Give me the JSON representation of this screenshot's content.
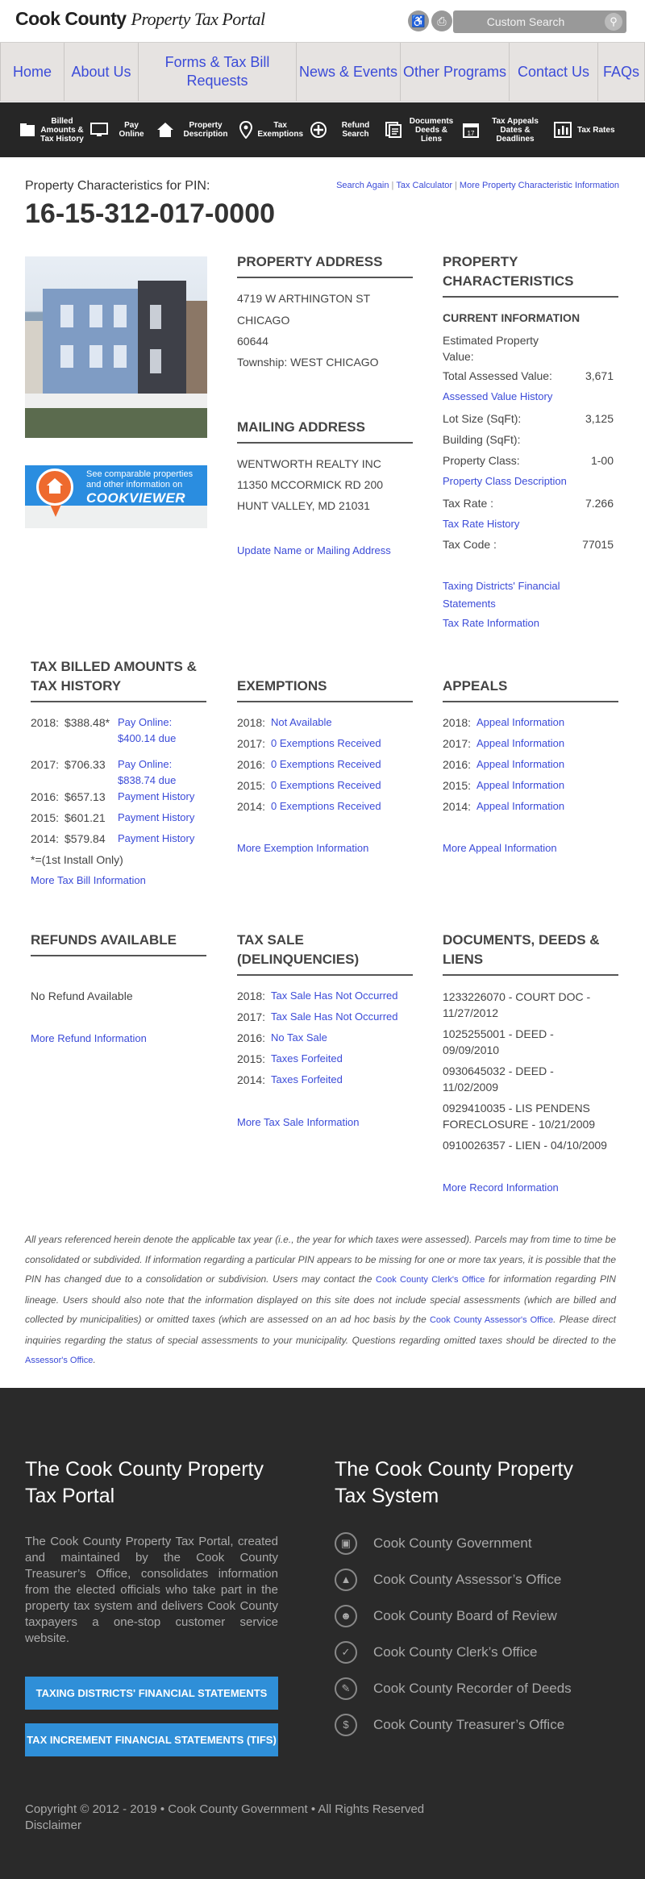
{
  "header": {
    "logo_brand": "Cook County",
    "logo_sub": "Property Tax Portal",
    "search_placeholder": "Custom Search"
  },
  "nav": [
    "Home",
    "About Us",
    "Forms & Tax Bill Requests",
    "News & Events",
    "Other Programs",
    "Contact Us",
    "FAQs"
  ],
  "toolbar": [
    {
      "icon": "billed-amounts-icon",
      "label": "Billed Amounts & Tax History"
    },
    {
      "icon": "pay-online-icon",
      "label": "Pay Online"
    },
    {
      "icon": "property-description-icon",
      "label": "Property Description"
    },
    {
      "icon": "tax-exemptions-icon",
      "label": "Tax Exemptions"
    },
    {
      "icon": "refund-search-icon",
      "label": "Refund Search"
    },
    {
      "icon": "documents-deeds-icon",
      "label": "Documents Deeds & Liens"
    },
    {
      "icon": "tax-appeals-icon",
      "label": "Tax Appeals Dates & Deadlines"
    },
    {
      "icon": "tax-rates-icon",
      "label": "Tax Rates"
    }
  ],
  "pin_section": {
    "label": "Property Characteristics for PIN:",
    "pin": "16-15-312-017-0000",
    "links": [
      "Search Again",
      "Tax Calculator",
      "More Property Characteristic Information"
    ]
  },
  "cookviewer": {
    "line1": "See comparable properties and other information on",
    "brand": "COOKVIEWER"
  },
  "property_address": {
    "heading": "PROPERTY ADDRESS",
    "street": "4719 W ARTHINGTON ST",
    "city": "CHICAGO",
    "zip": "60644",
    "township": "Township: WEST CHICAGO"
  },
  "mailing_address": {
    "heading": "MAILING ADDRESS",
    "line1": "WENTWORTH REALTY INC",
    "line2": "11350 MCCORMICK RD 200",
    "line3": "HUNT VALLEY, MD 21031",
    "update_link": "Update Name or Mailing Address"
  },
  "characteristics": {
    "heading": "PROPERTY CHARACTERISTICS",
    "subheading": "CURRENT INFORMATION",
    "est_value_label": "Estimated Property Value:",
    "est_value": "",
    "assessed_label": "Total Assessed Value:",
    "assessed_value": "3,671",
    "assessed_link": "Assessed Value History",
    "lot_label": "Lot Size (SqFt):",
    "lot_value": "3,125",
    "building_label": "Building (SqFt):",
    "building_value": "",
    "class_label": "Property Class:",
    "class_value": "1-00",
    "class_link": "Property Class Description",
    "rate_label": "Tax Rate :",
    "rate_value": "7.266",
    "rate_link": "Tax Rate History",
    "code_label": "Tax Code :",
    "code_value": "77015",
    "districts_link": "Taxing Districts' Financial Statements",
    "rate_info_link": "Tax Rate Information"
  },
  "tax_billed": {
    "heading": "TAX BILLED AMOUNTS & TAX HISTORY",
    "rows": [
      {
        "year": "2018:",
        "amount": "$388.48*",
        "link": "Pay Online: $400.14 due"
      },
      {
        "year": "2017:",
        "amount": "$706.33",
        "link": "Pay Online: $838.74 due"
      },
      {
        "year": "2016:",
        "amount": "$657.13",
        "link": "Payment History"
      },
      {
        "year": "2015:",
        "amount": "$601.21",
        "link": "Payment History"
      },
      {
        "year": "2014:",
        "amount": "$579.84",
        "link": "Payment History"
      }
    ],
    "note": "*=(1st Install Only)",
    "more": "More Tax Bill Information"
  },
  "exemptions": {
    "heading": "EXEMPTIONS",
    "rows": [
      {
        "year": "2018:",
        "link": "Not Available"
      },
      {
        "year": "2017:",
        "link": "0 Exemptions Received"
      },
      {
        "year": "2016:",
        "link": "0 Exemptions Received"
      },
      {
        "year": "2015:",
        "link": "0 Exemptions Received"
      },
      {
        "year": "2014:",
        "link": "0 Exemptions Received"
      }
    ],
    "more": "More Exemption Information"
  },
  "appeals": {
    "heading": "APPEALS",
    "rows": [
      {
        "year": "2018:",
        "link": "Appeal Information"
      },
      {
        "year": "2017:",
        "link": "Appeal Information"
      },
      {
        "year": "2016:",
        "link": "Appeal Information"
      },
      {
        "year": "2015:",
        "link": "Appeal Information"
      },
      {
        "year": "2014:",
        "link": "Appeal Information"
      }
    ],
    "more": "More Appeal Information"
  },
  "refunds": {
    "heading": "REFUNDS AVAILABLE",
    "status": "No Refund Available",
    "more": "More Refund Information"
  },
  "tax_sale": {
    "heading": "TAX SALE (DELINQUENCIES)",
    "rows": [
      {
        "year": "2018:",
        "link": "Tax Sale Has Not Occurred"
      },
      {
        "year": "2017:",
        "link": "Tax Sale Has Not Occurred"
      },
      {
        "year": "2016:",
        "link": "No Tax Sale"
      },
      {
        "year": "2015:",
        "link": "Taxes Forfeited"
      },
      {
        "year": "2014:",
        "link": "Taxes Forfeited"
      }
    ],
    "more": "More Tax Sale Information"
  },
  "documents": {
    "heading": "DOCUMENTS, DEEDS & LIENS",
    "items": [
      "1233226070 - COURT DOC - 11/27/2012",
      "1025255001 - DEED - 09/09/2010",
      "0930645032 - DEED - 11/02/2009",
      "0929410035 - LIS PENDENS FORECLOSURE - 10/21/2009",
      "0910026357 - LIEN - 04/10/2009"
    ],
    "more": "More Record Information"
  },
  "disclaimer": {
    "p1": "All years referenced herein denote the applicable tax year (i.e., the year for which taxes were assessed). Parcels may from time to time be consolidated or subdivided. If information regarding a particular PIN appears to be missing for one or more tax years, it is possible that the PIN has changed due to a consolidation or subdivision. Users may contact the",
    "clerk_link": "Cook County Clerk's Office",
    "p2": "for information regarding PIN lineage. Users should also note that the information displayed on this site does not include special assessments (which are billed and collected by municipalities) or omitted taxes (which are assessed on an ad hoc basis by the",
    "assessor_link": "Cook County Assessor's Office",
    "p3": ". Please direct inquiries regarding the status of special assessments to your municipality. Questions regarding omitted taxes should be directed to the",
    "assessor_link2": "Assessor's Office",
    "p4": "."
  },
  "footer": {
    "portal_heading": "The Cook County Property Tax Portal",
    "portal_text": "The Cook County Property Tax Portal, created and maintained by the Cook County Treasurer’s Office, consolidates information from the elected officials who take part in the property tax system and delivers Cook County taxpayers a one-stop customer service website.",
    "btn1": "TAXING DISTRICTS' FINANCIAL STATEMENTS",
    "btn2": "TAX INCREMENT FINANCIAL STATEMENTS (TIFS)",
    "system_heading": "The Cook County Property Tax System",
    "orgs": [
      {
        "icon": "government-building-icon",
        "label": "Cook County Government"
      },
      {
        "icon": "thumbs-up-icon",
        "label": "Cook County Assessor’s Office"
      },
      {
        "icon": "group-icon",
        "label": "Cook County Board of Review"
      },
      {
        "icon": "checkmark-icon",
        "label": "Cook County Clerk’s Office"
      },
      {
        "icon": "pencil-icon",
        "label": "Cook County Recorder of Deeds"
      },
      {
        "icon": "dollar-icon",
        "label": "Cook County Treasurer’s Office"
      }
    ],
    "copyright": "Copyright © 2012 - 2019 • Cook County Government • All Rights Reserved",
    "disclaimer_link": "Disclaimer"
  }
}
